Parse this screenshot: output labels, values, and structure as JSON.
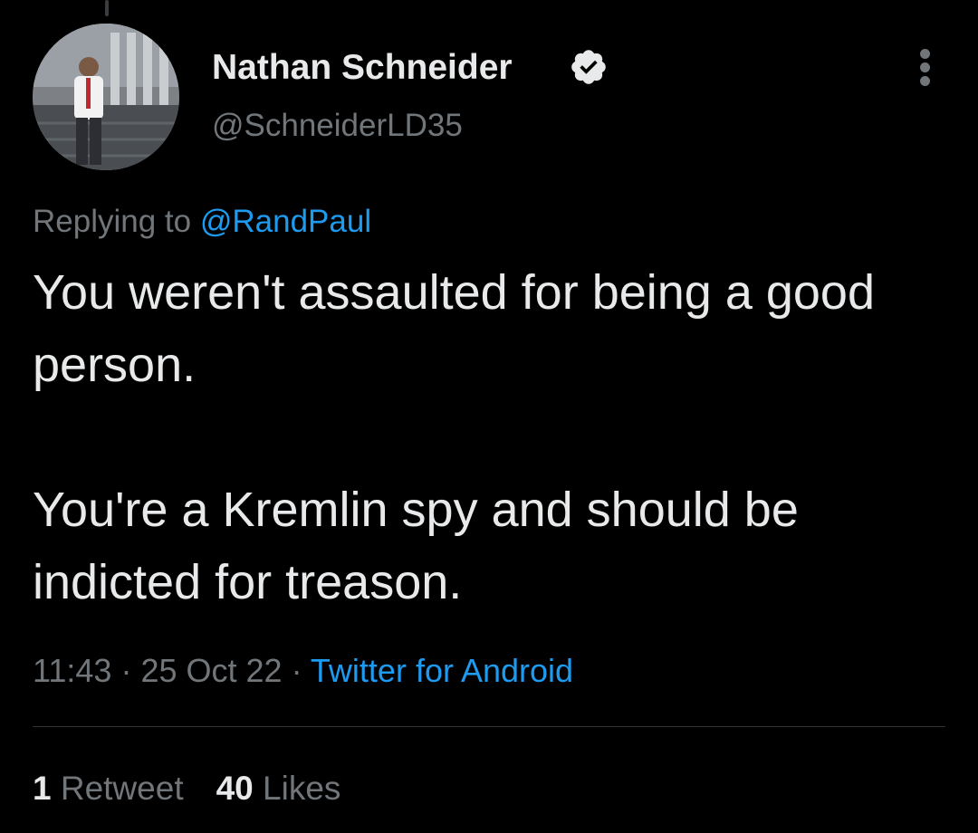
{
  "tweet": {
    "author": {
      "display_name": "Nathan Schneider",
      "handle": "@SchneiderLD35",
      "verified": true,
      "avatar": "profile-photo"
    },
    "reply": {
      "prefix": "Replying to",
      "mention": "@RandPaul"
    },
    "text": "You weren't assaulted for being a good person.\n\nYou're a Kremlin spy and should be indicted for treason.",
    "meta": {
      "time": "11:43",
      "separator": "·",
      "date": "25 Oct 22",
      "source": "Twitter for Android"
    },
    "stats": {
      "retweets_count": "1",
      "retweets_label": "Retweet",
      "likes_count": "40",
      "likes_label": "Likes"
    }
  },
  "icons": {
    "verified": "verified-badge-icon",
    "more": "more-options-icon"
  },
  "colors": {
    "background": "#000000",
    "text": "#e7e9ea",
    "secondary": "#71767b",
    "link": "#1d9bf0",
    "divider": "#2f3336"
  }
}
